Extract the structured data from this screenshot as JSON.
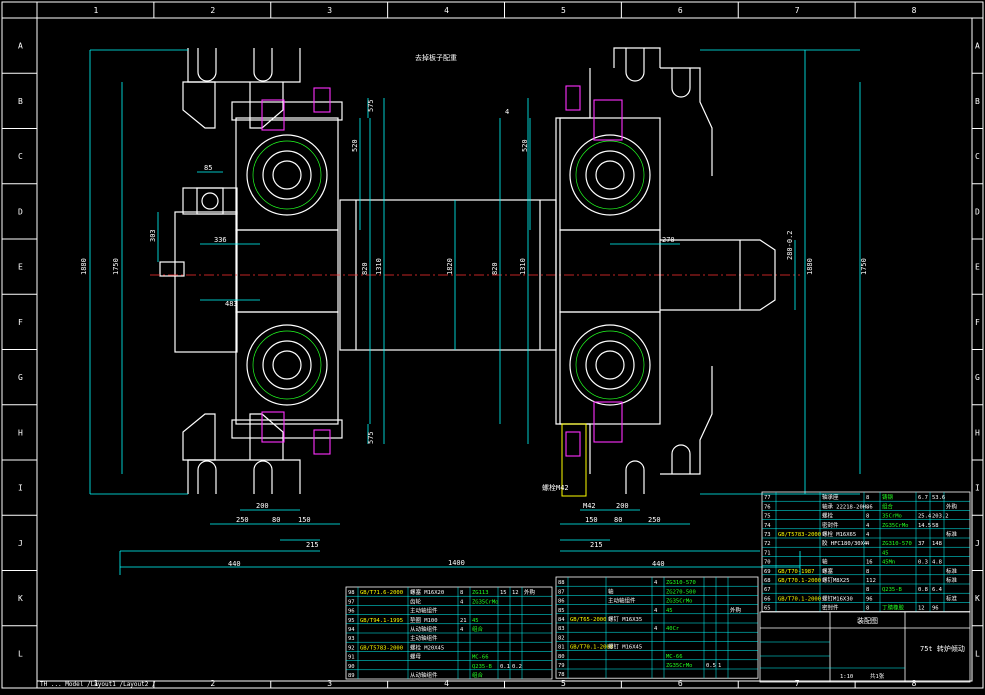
{
  "drawing": {
    "view_label": "去掉板子配重",
    "zones_top": [
      "1",
      "2",
      "3",
      "4",
      "5",
      "6",
      "7",
      "8"
    ],
    "zones_side": [
      "A",
      "B",
      "C",
      "D",
      "E",
      "F",
      "G",
      "H",
      "I",
      "J",
      "K",
      "L"
    ],
    "status_bar": "TH ... Model /Layout1 /Layout2 /"
  },
  "dims": {
    "total_width": "1400",
    "left_440": "440",
    "right_440": "440",
    "left_250": "250",
    "left_150": "150",
    "left_80": "80",
    "left_215": "215",
    "left_200": "200",
    "right_150": "150",
    "right_80": "80",
    "right_250": "250",
    "right_215": "215",
    "right_200": "200",
    "h_1880_left": "1880",
    "h_1750_left": "1750",
    "h_1880_right": "1880",
    "h_1750_right": "1750",
    "h_820_l": "820",
    "h_1310_l": "1310",
    "h_1820_c": "1820",
    "h_820_r": "820",
    "h_1310_r": "1310",
    "h_520_l": "520",
    "h_520_r": "520",
    "h_575_lt": "575",
    "h_575_lb": "575",
    "d_303": "303",
    "d_85": "85",
    "d_336": "336",
    "d_483": "483",
    "d_270": "270",
    "d_4": "4",
    "shaft_d": "280-0.2",
    "m42": "M42",
    "note_left": "螺栓M42"
  },
  "parts_right": {
    "rows": [
      {
        "no": "77",
        "code": "",
        "name": "轴承座",
        "qty": "8",
        "mat": "铸钢",
        "w1": "6.7",
        "w2": "53.6",
        "note": ""
      },
      {
        "no": "76",
        "code": "",
        "name": "轴承 22218-20H-6",
        "qty": "8",
        "mat": "组合",
        "w1": "",
        "w2": "",
        "note": "外购"
      },
      {
        "no": "75",
        "code": "",
        "name": "螺栓",
        "qty": "8",
        "mat": "35CrMo",
        "w1": "25.4",
        "w2": "203.2",
        "note": ""
      },
      {
        "no": "74",
        "code": "",
        "name": "密封件",
        "qty": "4",
        "mat": "ZG35CrMo",
        "w1": "14.5",
        "w2": "58",
        "note": ""
      },
      {
        "no": "73",
        "code": "GB/T5783-2000",
        "name": "螺栓 M16X65",
        "qty": "4",
        "mat": "",
        "w1": "",
        "w2": "",
        "note": "标准"
      },
      {
        "no": "72",
        "code": "",
        "name": "胶 HFC180/30X4",
        "qty": "4",
        "mat": "ZG310-570",
        "w1": "37",
        "w2": "148",
        "note": ""
      },
      {
        "no": "71",
        "code": "",
        "name": "",
        "qty": "",
        "mat": "45",
        "w1": "",
        "w2": "",
        "note": ""
      },
      {
        "no": "70",
        "code": "",
        "name": "轴",
        "qty": "16",
        "mat": "45Mn",
        "w1": "0.3",
        "w2": "4.8",
        "note": ""
      },
      {
        "no": "69",
        "code": "GB/T70-1987",
        "name": "螺塞",
        "qty": "8",
        "mat": "",
        "w1": "",
        "w2": "",
        "note": "标准"
      },
      {
        "no": "68",
        "code": "GB/T70.1-2000",
        "name": "螺钉M8X25",
        "qty": "112",
        "mat": "",
        "w1": "",
        "w2": "",
        "note": "标准"
      },
      {
        "no": "67",
        "code": "",
        "name": "",
        "qty": "8",
        "mat": "Q235-B",
        "w1": "0.8",
        "w2": "6.4",
        "note": ""
      },
      {
        "no": "66",
        "code": "GB/T70.1-2000",
        "name": "螺钉M16X30",
        "qty": "96",
        "mat": "",
        "w1": "",
        "w2": "",
        "note": "标准"
      },
      {
        "no": "65",
        "code": "",
        "name": "密封件",
        "qty": "8",
        "mat": "丁腈橡胶",
        "w1": "12",
        "w2": "96",
        "note": ""
      }
    ]
  },
  "parts_left": {
    "rows": [
      {
        "no": "98",
        "code": "GB/T71.6-2000",
        "name": "螺塞 M16X20",
        "qty": "8",
        "mat": "ZG113",
        "w1": "15",
        "w2": "12",
        "note": "外购"
      },
      {
        "no": "97",
        "code": "",
        "name": "齿轮",
        "qty": "4",
        "mat": "ZG35CrMo",
        "w1": "",
        "w2": "",
        "note": ""
      },
      {
        "no": "96",
        "code": "",
        "name": "主动轴组件",
        "qty": "",
        "mat": "",
        "w1": "",
        "w2": "",
        "note": ""
      },
      {
        "no": "95",
        "code": "GB/T94.1-1995",
        "name": "垫圈 M100",
        "qty": "21",
        "mat": "45",
        "w1": "",
        "w2": "",
        "note": ""
      },
      {
        "no": "94",
        "code": "",
        "name": "从动轴组件",
        "qty": "4",
        "mat": "组合",
        "w1": "",
        "w2": "",
        "note": ""
      },
      {
        "no": "93",
        "code": "",
        "name": "主动轴组件",
        "qty": "",
        "mat": "",
        "w1": "",
        "w2": "",
        "note": ""
      },
      {
        "no": "92",
        "code": "GB/T5783-2000",
        "name": "螺栓 M20X45",
        "qty": "",
        "mat": "",
        "w1": "",
        "w2": "",
        "note": ""
      },
      {
        "no": "91",
        "code": "",
        "name": "螺母",
        "qty": "",
        "mat": "MC-66",
        "w1": "",
        "w2": "",
        "note": ""
      },
      {
        "no": "90",
        "code": "",
        "name": "",
        "qty": "",
        "mat": "Q235-B",
        "w1": "0.1",
        "w2": "0.2",
        "note": ""
      },
      {
        "no": "89",
        "code": "",
        "name": "从动轴组件",
        "qty": "",
        "mat": "组合",
        "w1": "",
        "w2": "",
        "note": ""
      }
    ]
  },
  "parts_mid": {
    "rows": [
      {
        "no": "88",
        "code": "",
        "name": "",
        "qty": "4",
        "mat": "ZG310-570",
        "w1": "",
        "w2": "",
        "note": ""
      },
      {
        "no": "87",
        "code": "",
        "name": "轴",
        "qty": "",
        "mat": "ZG270-500",
        "w1": "",
        "w2": "",
        "note": ""
      },
      {
        "no": "86",
        "code": "",
        "name": "主动轴组件",
        "qty": "",
        "mat": "ZG35CrMo",
        "w1": "",
        "w2": "",
        "note": ""
      },
      {
        "no": "85",
        "code": "",
        "name": "",
        "qty": "4",
        "mat": "45",
        "w1": "",
        "w2": "",
        "note": "外购"
      },
      {
        "no": "84",
        "code": "GB/T65-2000",
        "name": "螺钉 M16X35",
        "qty": "",
        "mat": "",
        "w1": "",
        "w2": "",
        "note": ""
      },
      {
        "no": "83",
        "code": "",
        "name": "",
        "qty": "4",
        "mat": "40Cr",
        "w1": "",
        "w2": "",
        "note": ""
      },
      {
        "no": "82",
        "code": "",
        "name": "",
        "qty": "",
        "mat": "",
        "w1": "",
        "w2": "",
        "note": ""
      },
      {
        "no": "81",
        "code": "GB/T70.1-2000",
        "name": "螺钉 M16X45",
        "qty": "",
        "mat": "",
        "w1": "",
        "w2": "",
        "note": ""
      },
      {
        "no": "80",
        "code": "",
        "name": "",
        "qty": "",
        "mat": "MC-66",
        "w1": "",
        "w2": "",
        "note": ""
      },
      {
        "no": "79",
        "code": "",
        "name": "",
        "qty": "",
        "mat": "ZG35CrMo",
        "w1": "0.5",
        "w2": "1",
        "note": ""
      },
      {
        "no": "78",
        "code": "",
        "name": "",
        "qty": "",
        "mat": "",
        "w1": "",
        "w2": "",
        "note": ""
      }
    ]
  },
  "title_block": {
    "header": "装配图",
    "code": "75t 转炉倾动",
    "scale": "1:10",
    "sheet": "共1张"
  }
}
